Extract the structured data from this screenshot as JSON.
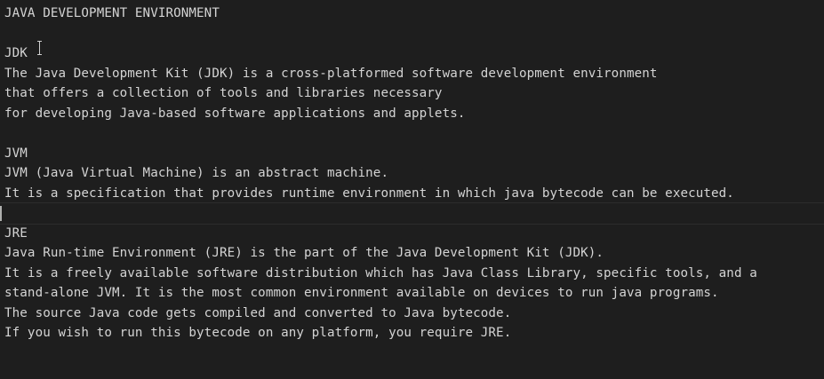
{
  "editor": {
    "lines": [
      "JAVA DEVELOPMENT ENVIRONMENT",
      "",
      "JDK",
      "The Java Development Kit (JDK) is a cross-platformed software development environment",
      "that offers a collection of tools and libraries necessary",
      "for developing Java-based software applications and applets.",
      "",
      "JVM",
      "JVM (Java Virtual Machine) is an abstract machine.",
      "It is a specification that provides runtime environment in which java bytecode can be executed.",
      "",
      "JRE",
      "Java Run-time Environment (JRE) is the part of the Java Development Kit (JDK).",
      "It is a freely available software distribution which has Java Class Library, specific tools, and a",
      "stand-alone JVM. It is the most common environment available on devices to run java programs.",
      "The source Java code gets compiled and converted to Java bytecode.",
      "If you wish to run this bytecode on any platform, you require JRE."
    ]
  },
  "colors": {
    "background": "#1e1e1e",
    "text": "#d4d4d4",
    "cursor": "#aeafad"
  },
  "icons": {
    "mouse_pointer": "text-ibeam-cursor-icon"
  }
}
